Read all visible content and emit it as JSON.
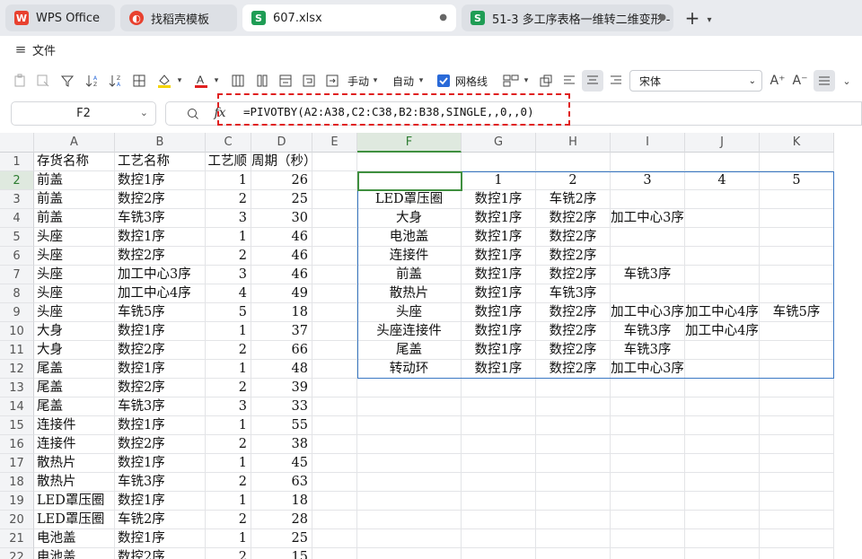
{
  "tabs": [
    {
      "label": "WPS Office",
      "icon": "wps-logo-icon",
      "color": "#e8412f"
    },
    {
      "label": "找稻壳模板",
      "icon": "docer-icon",
      "color": "#e8412f"
    },
    {
      "label": "607.xlsx",
      "icon": "spreadsheet-s-icon",
      "color": "#1f9d55"
    },
    {
      "label": "51-3 多工序表格一维转二维变形 -",
      "icon": "spreadsheet-s-icon",
      "color": "#1f9d55"
    }
  ],
  "menu": {
    "file_label": "文件"
  },
  "toolbar": {
    "manual_label": "手动",
    "auto_label": "自动",
    "gridlines_label": "网格线",
    "gridlines_checked": true,
    "font_name": "宋体",
    "font_color": "#e02020",
    "fill_color": "#f5d400"
  },
  "formula_bar": {
    "name_box": "F2",
    "fx_label": "fx",
    "formula": "=PIVOTBY(A2:A38,C2:C38,B2:B38,SINGLE,,0,,0)"
  },
  "columns": [
    "A",
    "B",
    "C",
    "D",
    "E",
    "F",
    "G",
    "H",
    "I",
    "J",
    "K"
  ],
  "rows": [
    {
      "n": "1",
      "A": "存货名称",
      "B": "工艺名称",
      "C": "工艺顺",
      "D": "周期（秒）",
      "F": "",
      "G": "",
      "H": "",
      "I": "",
      "J": "",
      "K": ""
    },
    {
      "n": "2",
      "A": "前盖",
      "B": "数控1序",
      "C": "1",
      "D": "26",
      "F": "",
      "G": "1",
      "H": "2",
      "I": "3",
      "J": "4",
      "K": "5"
    },
    {
      "n": "3",
      "A": "前盖",
      "B": "数控2序",
      "C": "2",
      "D": "25",
      "F": "LED罩压圈",
      "G": "数控1序",
      "H": "车铣2序",
      "I": "",
      "J": "",
      "K": ""
    },
    {
      "n": "4",
      "A": "前盖",
      "B": "车铣3序",
      "C": "3",
      "D": "30",
      "F": "大身",
      "G": "数控1序",
      "H": "数控2序",
      "I": "加工中心3序",
      "J": "",
      "K": ""
    },
    {
      "n": "5",
      "A": "头座",
      "B": "数控1序",
      "C": "1",
      "D": "46",
      "F": "电池盖",
      "G": "数控1序",
      "H": "数控2序",
      "I": "",
      "J": "",
      "K": ""
    },
    {
      "n": "6",
      "A": "头座",
      "B": "数控2序",
      "C": "2",
      "D": "46",
      "F": "连接件",
      "G": "数控1序",
      "H": "数控2序",
      "I": "",
      "J": "",
      "K": ""
    },
    {
      "n": "7",
      "A": "头座",
      "B": "加工中心3序",
      "C": "3",
      "D": "46",
      "F": "前盖",
      "G": "数控1序",
      "H": "数控2序",
      "I": "车铣3序",
      "J": "",
      "K": ""
    },
    {
      "n": "8",
      "A": "头座",
      "B": "加工中心4序",
      "C": "4",
      "D": "49",
      "F": "散热片",
      "G": "数控1序",
      "H": "车铣3序",
      "I": "",
      "J": "",
      "K": ""
    },
    {
      "n": "9",
      "A": "头座",
      "B": "车铣5序",
      "C": "5",
      "D": "18",
      "F": "头座",
      "G": "数控1序",
      "H": "数控2序",
      "I": "加工中心3序",
      "J": "加工中心4序",
      "K": "车铣5序"
    },
    {
      "n": "10",
      "A": "大身",
      "B": "数控1序",
      "C": "1",
      "D": "37",
      "F": "头座连接件",
      "G": "数控1序",
      "H": "数控2序",
      "I": "车铣3序",
      "J": "加工中心4序",
      "K": ""
    },
    {
      "n": "11",
      "A": "大身",
      "B": "数控2序",
      "C": "2",
      "D": "66",
      "F": "尾盖",
      "G": "数控1序",
      "H": "数控2序",
      "I": "车铣3序",
      "J": "",
      "K": ""
    },
    {
      "n": "12",
      "A": "尾盖",
      "B": "数控1序",
      "C": "1",
      "D": "48",
      "F": "转动环",
      "G": "数控1序",
      "H": "数控2序",
      "I": "加工中心3序",
      "J": "",
      "K": ""
    },
    {
      "n": "13",
      "A": "尾盖",
      "B": "数控2序",
      "C": "2",
      "D": "39",
      "F": "",
      "G": "",
      "H": "",
      "I": "",
      "J": "",
      "K": ""
    },
    {
      "n": "14",
      "A": "尾盖",
      "B": "车铣3序",
      "C": "3",
      "D": "33",
      "F": "",
      "G": "",
      "H": "",
      "I": "",
      "J": "",
      "K": ""
    },
    {
      "n": "15",
      "A": "连接件",
      "B": "数控1序",
      "C": "1",
      "D": "55",
      "F": "",
      "G": "",
      "H": "",
      "I": "",
      "J": "",
      "K": ""
    },
    {
      "n": "16",
      "A": "连接件",
      "B": "数控2序",
      "C": "2",
      "D": "38",
      "F": "",
      "G": "",
      "H": "",
      "I": "",
      "J": "",
      "K": ""
    },
    {
      "n": "17",
      "A": "散热片",
      "B": "数控1序",
      "C": "1",
      "D": "45",
      "F": "",
      "G": "",
      "H": "",
      "I": "",
      "J": "",
      "K": ""
    },
    {
      "n": "18",
      "A": "散热片",
      "B": "车铣3序",
      "C": "2",
      "D": "63",
      "F": "",
      "G": "",
      "H": "",
      "I": "",
      "J": "",
      "K": ""
    },
    {
      "n": "19",
      "A": "LED罩压圈",
      "B": "数控1序",
      "C": "1",
      "D": "18",
      "F": "",
      "G": "",
      "H": "",
      "I": "",
      "J": "",
      "K": ""
    },
    {
      "n": "20",
      "A": "LED罩压圈",
      "B": "车铣2序",
      "C": "2",
      "D": "28",
      "F": "",
      "G": "",
      "H": "",
      "I": "",
      "J": "",
      "K": ""
    },
    {
      "n": "21",
      "A": "电池盖",
      "B": "数控1序",
      "C": "1",
      "D": "25",
      "F": "",
      "G": "",
      "H": "",
      "I": "",
      "J": "",
      "K": ""
    },
    {
      "n": "22",
      "A": "电池盖",
      "B": "数控2序",
      "C": "2",
      "D": "15",
      "F": "",
      "G": "",
      "H": "",
      "I": "",
      "J": "",
      "K": ""
    }
  ],
  "selection": {
    "active_cell": "F2",
    "pivot_range": "F2:K12"
  }
}
